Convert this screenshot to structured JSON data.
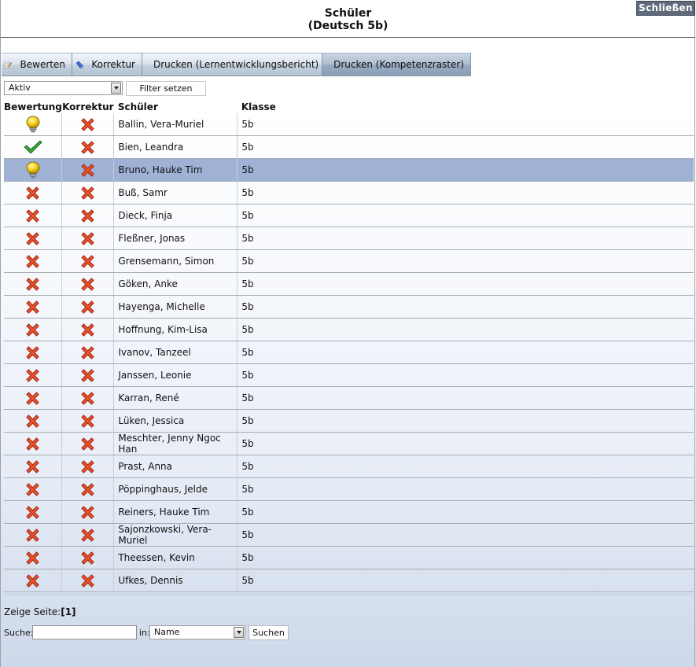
{
  "header": {
    "title_line1": "Schüler",
    "title_line2": "(Deutsch 5b)",
    "close_label": "Schließen"
  },
  "toolbar": {
    "items": [
      {
        "label": "Bewerten",
        "icon": "pencil-note-icon"
      },
      {
        "label": "Korrektur",
        "icon": "blue-pencil-icon"
      },
      {
        "label": "Drucken (Lernentwicklungsbericht)",
        "icon": "printer-icon"
      },
      {
        "label": "Drucken (Kompetenzraster)",
        "icon": "printer-icon"
      }
    ]
  },
  "filter": {
    "selected": "Aktiv",
    "button_label": "Filter setzen"
  },
  "table": {
    "columns": [
      "Bewertung",
      "Korrektur",
      "Schüler",
      "Klasse"
    ],
    "selected_index": 2,
    "rows": [
      {
        "bewertung": "lightbulb-icon",
        "korrektur": "red-x-icon",
        "name": "Ballin, Vera-Muriel",
        "klasse": "5b"
      },
      {
        "bewertung": "green-check-icon",
        "korrektur": "red-x-icon",
        "name": "Bien, Leandra",
        "klasse": "5b"
      },
      {
        "bewertung": "lightbulb-icon",
        "korrektur": "red-x-icon",
        "name": "Bruno, Hauke Tim",
        "klasse": "5b"
      },
      {
        "bewertung": "red-x-icon",
        "korrektur": "red-x-icon",
        "name": "Buß, Samr",
        "klasse": "5b"
      },
      {
        "bewertung": "red-x-icon",
        "korrektur": "red-x-icon",
        "name": "Dieck, Finja",
        "klasse": "5b"
      },
      {
        "bewertung": "red-x-icon",
        "korrektur": "red-x-icon",
        "name": "Fleßner, Jonas",
        "klasse": "5b"
      },
      {
        "bewertung": "red-x-icon",
        "korrektur": "red-x-icon",
        "name": "Grensemann, Simon",
        "klasse": "5b"
      },
      {
        "bewertung": "red-x-icon",
        "korrektur": "red-x-icon",
        "name": "Göken, Anke",
        "klasse": "5b"
      },
      {
        "bewertung": "red-x-icon",
        "korrektur": "red-x-icon",
        "name": "Hayenga, Michelle",
        "klasse": "5b"
      },
      {
        "bewertung": "red-x-icon",
        "korrektur": "red-x-icon",
        "name": "Hoffnung, Kim-Lisa",
        "klasse": "5b"
      },
      {
        "bewertung": "red-x-icon",
        "korrektur": "red-x-icon",
        "name": "Ivanov, Tanzeel",
        "klasse": "5b"
      },
      {
        "bewertung": "red-x-icon",
        "korrektur": "red-x-icon",
        "name": "Janssen, Leonie",
        "klasse": "5b"
      },
      {
        "bewertung": "red-x-icon",
        "korrektur": "red-x-icon",
        "name": "Karran, René",
        "klasse": "5b"
      },
      {
        "bewertung": "red-x-icon",
        "korrektur": "red-x-icon",
        "name": "Lüken, Jessica",
        "klasse": "5b"
      },
      {
        "bewertung": "red-x-icon",
        "korrektur": "red-x-icon",
        "name": "Meschter, Jenny Ngoc Han",
        "klasse": "5b"
      },
      {
        "bewertung": "red-x-icon",
        "korrektur": "red-x-icon",
        "name": "Prast, Anna",
        "klasse": "5b"
      },
      {
        "bewertung": "red-x-icon",
        "korrektur": "red-x-icon",
        "name": "Pöppinghaus, Jelde",
        "klasse": "5b"
      },
      {
        "bewertung": "red-x-icon",
        "korrektur": "red-x-icon",
        "name": "Reiners, Hauke Tim",
        "klasse": "5b"
      },
      {
        "bewertung": "red-x-icon",
        "korrektur": "red-x-icon",
        "name": "Sajonzkowski, Vera-Muriel",
        "klasse": "5b"
      },
      {
        "bewertung": "red-x-icon",
        "korrektur": "red-x-icon",
        "name": "Theessen, Kevin",
        "klasse": "5b"
      },
      {
        "bewertung": "red-x-icon",
        "korrektur": "red-x-icon",
        "name": "Ufkes, Dennis",
        "klasse": "5b"
      }
    ]
  },
  "pager": {
    "label": "Zeige Seite:",
    "current": "[1]"
  },
  "search": {
    "label": "Suche:",
    "value": "",
    "in_label": "in:",
    "field_selected": "Name",
    "button_label": "Suchen"
  },
  "colors": {
    "selected_row": "#9fb2d6",
    "close_button": "#5f6b7b"
  }
}
